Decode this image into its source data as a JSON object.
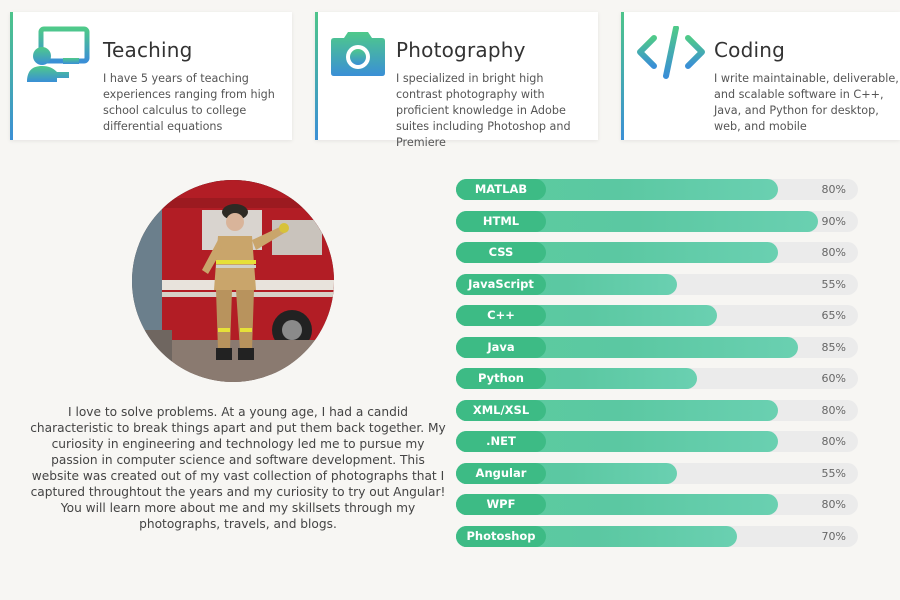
{
  "services": [
    {
      "title": "Teaching",
      "icon": "teacher-board-icon",
      "description": "I have 5 years of teaching experiences ranging from high school calculus to college differential equations"
    },
    {
      "title": "Photography",
      "icon": "camera-icon",
      "description": "I specialized in bright high contrast photography with proficient knowledge in Adobe suites including Photoshop and Premiere"
    },
    {
      "title": "Coding",
      "icon": "code-brackets-icon",
      "description": "I write maintainable, deliverable, and scalable software in C++, Java, and Python for desktop, web, and mobile"
    }
  ],
  "about": {
    "bio": "I love to solve problems. At a young age, I had a candid characteristic to break things apart and put them back together. My curiosity in engineering and technology led me to pursue my passion in computer science and software development. This website was created out of my vast collection of photographs that I captured throughtout the years and my curiosity to try out Angular! You will learn more about me and my skillsets through my photographs, travels, and blogs."
  },
  "skills": [
    {
      "name": "MATLAB",
      "level": 80,
      "pct_label": "80%"
    },
    {
      "name": "HTML",
      "level": 90,
      "pct_label": "90%"
    },
    {
      "name": "CSS",
      "level": 80,
      "pct_label": "80%"
    },
    {
      "name": "JavaScript",
      "level": 55,
      "pct_label": "55%"
    },
    {
      "name": "C++",
      "level": 65,
      "pct_label": "65%"
    },
    {
      "name": "Java",
      "level": 85,
      "pct_label": "85%"
    },
    {
      "name": "Python",
      "level": 60,
      "pct_label": "60%"
    },
    {
      "name": "XML/XSL",
      "level": 80,
      "pct_label": "80%"
    },
    {
      "name": ".NET",
      "level": 80,
      "pct_label": "80%"
    },
    {
      "name": "Angular",
      "level": 55,
      "pct_label": "55%"
    },
    {
      "name": "WPF",
      "level": 80,
      "pct_label": "80%"
    },
    {
      "name": "Photoshop",
      "level": 70,
      "pct_label": "70%"
    }
  ],
  "colors": {
    "accent_green": "#3dbb85",
    "accent_teal": "#5ccc9e",
    "accent_blue": "#3b8fd6",
    "track": "#ebebeb",
    "background": "#f7f6f3"
  }
}
